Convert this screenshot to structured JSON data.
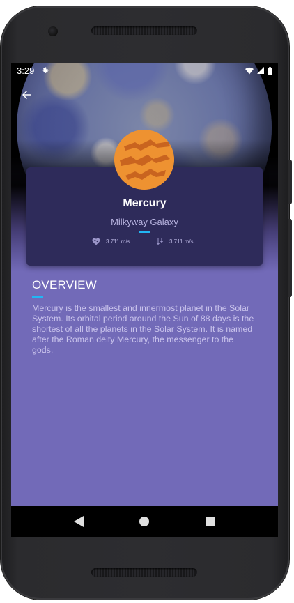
{
  "status_bar": {
    "time": "3:29",
    "icons": [
      "gear-icon",
      "wifi-icon",
      "signal-icon",
      "battery-icon"
    ]
  },
  "toolbar": {
    "back_icon": "arrow-left-icon"
  },
  "planet": {
    "name": "Mercury",
    "galaxy": "Milkyway Galaxy",
    "stats": [
      {
        "icon": "heart-icon",
        "value": "3.711 m/s"
      },
      {
        "icon": "gravity-arrow-icon",
        "value": "3.711 m/s"
      }
    ],
    "thumbnail_color": "#ee9231"
  },
  "overview": {
    "title": "OVERVIEW",
    "text": "Mercury is the smallest and innermost planet in the Solar System. Its orbital period around the Sun of 88 days is the shortest of all the planets in the Solar System. It is named after the Roman deity Mercury, the messenger to the gods."
  },
  "nav_bar": {
    "buttons": [
      "back-triangle-icon",
      "home-circle-icon",
      "recents-square-icon"
    ]
  },
  "colors": {
    "background": "#726ab8",
    "card": "#2e2b5a",
    "accent": "#22b6f4",
    "text_muted": "#c9c3ec"
  }
}
